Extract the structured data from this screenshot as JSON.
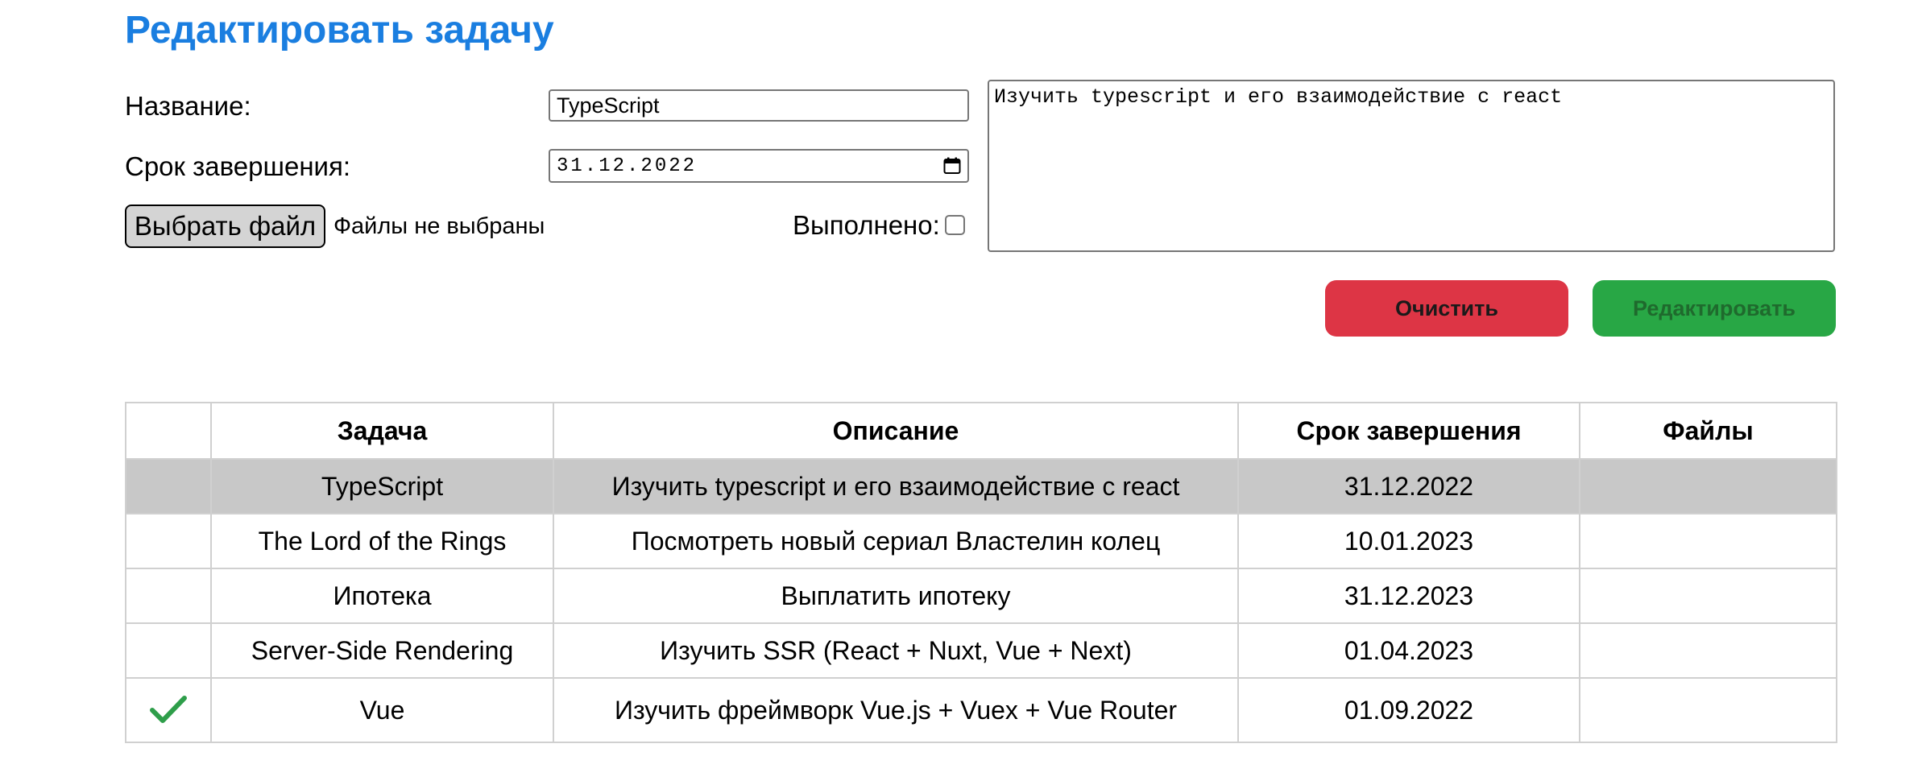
{
  "page": {
    "title": "Редактировать задачу"
  },
  "form": {
    "name_label": "Название:",
    "name_value": "TypeScript",
    "deadline_label": "Срок завершения:",
    "deadline_value": "31.12.2022",
    "file_button_label": "Выбрать файл",
    "file_status": "Файлы не выбраны",
    "done_label": "Выполнено:",
    "done_checked": false,
    "description_value": "Изучить typescript и его взаимодействие с react",
    "clear_label": "Очистить",
    "edit_label": "Редактировать"
  },
  "table": {
    "headers": [
      "",
      "Задача",
      "Описание",
      "Срок завершения",
      "Файлы"
    ],
    "rows": [
      {
        "done": false,
        "task": "TypeScript",
        "description": "Изучить typescript и его взаимодействие с react",
        "deadline": "31.12.2022",
        "files": "",
        "selected": true
      },
      {
        "done": false,
        "task": "The Lord of the Rings",
        "description": "Посмотреть новый сериал Властелин колец",
        "deadline": "10.01.2023",
        "files": "",
        "selected": false
      },
      {
        "done": false,
        "task": "Ипотека",
        "description": "Выплатить ипотеку",
        "deadline": "31.12.2023",
        "files": "",
        "selected": false
      },
      {
        "done": false,
        "task": "Server-Side Rendering",
        "description": "Изучить SSR (React + Nuxt, Vue + Next)",
        "deadline": "01.04.2023",
        "files": "",
        "selected": false
      },
      {
        "done": true,
        "task": "Vue",
        "description": "Изучить фреймворк Vue.js + Vuex + Vue Router",
        "deadline": "01.09.2022",
        "files": "",
        "selected": false
      }
    ]
  },
  "icons": {
    "done_icon": "check-icon",
    "calendar_icon": "calendar-icon"
  },
  "colors": {
    "title": "#1a7ee0",
    "clear_button": "#dd3545",
    "edit_button": "#28a745",
    "selected_row": "#c8c8c8",
    "check": "#2e9e4a"
  }
}
